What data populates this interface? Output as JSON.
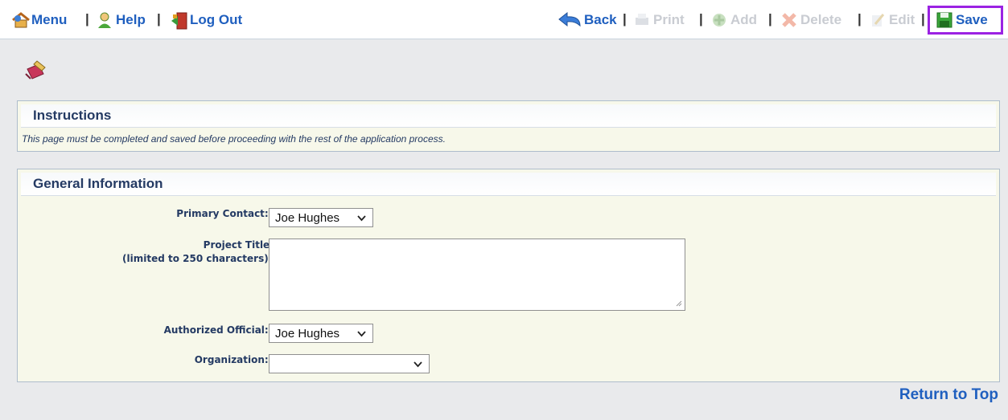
{
  "toolbar": {
    "left_items": [
      {
        "label": "Menu",
        "icon": "menu-home-icon"
      },
      {
        "label": "Help",
        "icon": "help-person-icon"
      },
      {
        "label": "Log Out",
        "icon": "logout-door-icon"
      }
    ],
    "right_items": [
      {
        "label": "Back",
        "icon": "back-arrow-icon",
        "enabled": true
      },
      {
        "label": "Print",
        "icon": "print-icon",
        "enabled": false
      },
      {
        "label": "Add",
        "icon": "add-icon",
        "enabled": false
      },
      {
        "label": "Delete",
        "icon": "delete-icon",
        "enabled": false
      },
      {
        "label": "Edit",
        "icon": "edit-icon",
        "enabled": false
      },
      {
        "label": "Save",
        "icon": "save-disk-icon",
        "enabled": true
      }
    ],
    "separator": "|"
  },
  "instructions": {
    "title": "Instructions",
    "text": "This page must be completed and saved before proceeding with the rest of the application process."
  },
  "general": {
    "title": "General Information",
    "primary_contact": {
      "label": "Primary Contact:",
      "value": "Joe Hughes"
    },
    "project_title": {
      "label_line1": "Project Title:",
      "label_line2": "(limited to 250 characters)",
      "value": ""
    },
    "authorized_official": {
      "label": "Authorized Official:",
      "value": "Joe Hughes"
    },
    "organization": {
      "label": "Organization:",
      "value": ""
    },
    "required_marker": "*"
  },
  "footer": {
    "return_to_top": "Return to Top"
  },
  "colors": {
    "link": "#1f5fbf",
    "highlight": "#9b22e3",
    "panel": "#f7f8ea",
    "required": "#e02020"
  }
}
